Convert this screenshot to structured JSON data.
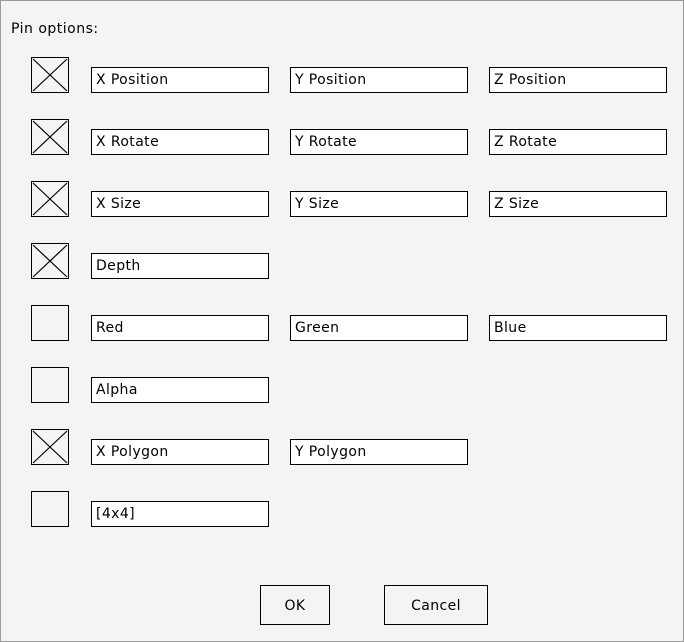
{
  "dialog": {
    "title": "Pin options:"
  },
  "rows": [
    {
      "checked": true,
      "fields": [
        "X Position",
        "Y Position",
        "Z Position"
      ]
    },
    {
      "checked": true,
      "fields": [
        "X Rotate",
        "Y Rotate",
        "Z Rotate"
      ]
    },
    {
      "checked": true,
      "fields": [
        "X Size",
        "Y Size",
        "Z Size"
      ]
    },
    {
      "checked": true,
      "fields": [
        "Depth"
      ]
    },
    {
      "checked": false,
      "fields": [
        "Red",
        "Green",
        "Blue"
      ]
    },
    {
      "checked": false,
      "fields": [
        "Alpha"
      ]
    },
    {
      "checked": true,
      "fields": [
        "X Polygon",
        "Y Polygon"
      ]
    },
    {
      "checked": false,
      "fields": [
        "[4x4]"
      ]
    }
  ],
  "buttons": {
    "ok_label": "OK",
    "cancel_label": "Cancel"
  }
}
